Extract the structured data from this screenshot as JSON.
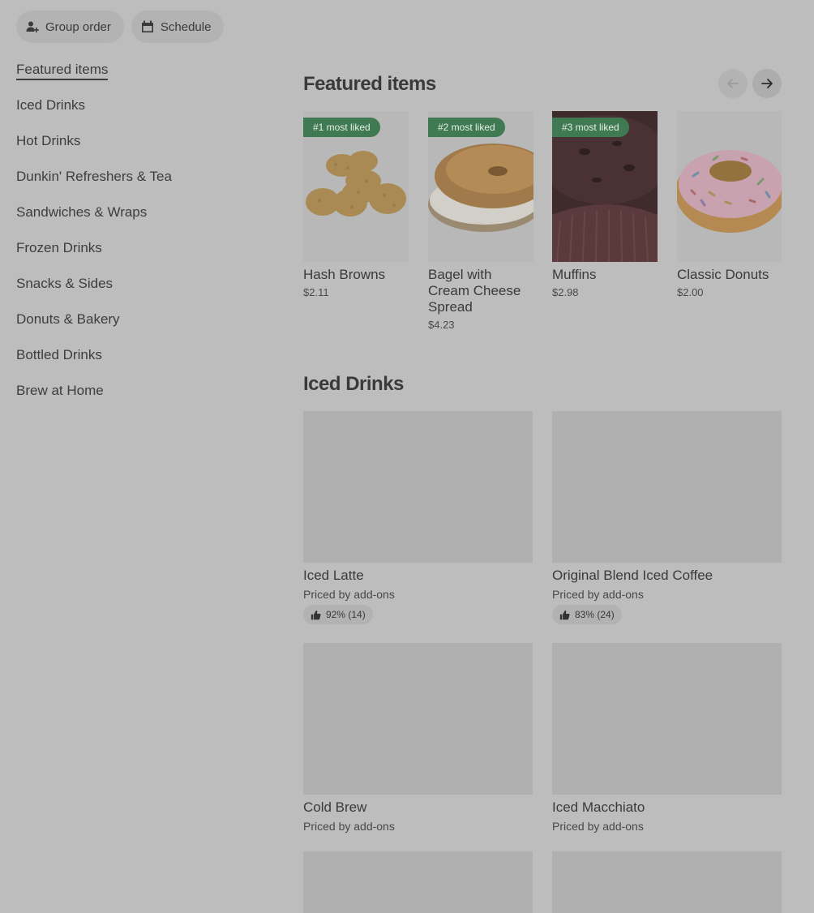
{
  "top_actions": {
    "group_order": "Group order",
    "schedule": "Schedule"
  },
  "sidebar": {
    "items": [
      {
        "label": "Featured items",
        "active": true
      },
      {
        "label": "Iced Drinks"
      },
      {
        "label": "Hot Drinks"
      },
      {
        "label": "Dunkin' Refreshers & Tea"
      },
      {
        "label": "Sandwiches & Wraps"
      },
      {
        "label": "Frozen Drinks"
      },
      {
        "label": "Snacks & Sides"
      },
      {
        "label": "Donuts & Bakery"
      },
      {
        "label": "Bottled Drinks"
      },
      {
        "label": "Brew at Home"
      }
    ]
  },
  "featured": {
    "title": "Featured items",
    "items": [
      {
        "badge": "#1 most liked",
        "name": "Hash Browns",
        "price": "$2.11",
        "image": "hash-browns-image"
      },
      {
        "badge": "#2 most liked",
        "name": "Bagel with Cream Cheese Spread",
        "price": "$4.23",
        "image": "bagel-image"
      },
      {
        "badge": "#3 most liked",
        "name": "Muffins",
        "price": "$2.98",
        "image": "muffin-image"
      },
      {
        "badge": "",
        "name": "Classic Donuts",
        "price": "$2.00",
        "image": "donut-image"
      }
    ]
  },
  "iced": {
    "title": "Iced Drinks",
    "items": [
      {
        "name": "Iced Latte",
        "sub": "Priced by add-ons",
        "rating": "92% (14)"
      },
      {
        "name": "Original Blend Iced Coffee",
        "sub": "Priced by add-ons",
        "rating": "83% (24)"
      },
      {
        "name": "Cold Brew",
        "sub": "Priced by add-ons"
      },
      {
        "name": "Iced Macchiato",
        "sub": "Priced by add-ons"
      }
    ]
  },
  "colors": {
    "overlay_bg": "#bdbdbd",
    "badge_green": "#3f7a52"
  }
}
